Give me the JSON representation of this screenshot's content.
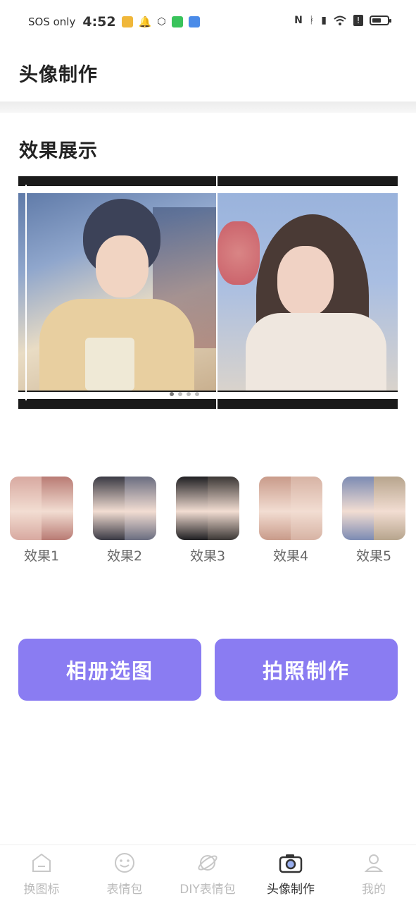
{
  "status_bar": {
    "carrier": "SOS only",
    "time": "4:52",
    "battery_level": 0.6
  },
  "header": {
    "title": "头像制作"
  },
  "showcase": {
    "title": "效果展示",
    "slide_count": 4,
    "active_slide": 0
  },
  "effects": [
    {
      "label": "效果1",
      "colors": [
        "#d8a9a0",
        "#b97b74"
      ]
    },
    {
      "label": "效果2",
      "colors": [
        "#3a3a44",
        "#6a6d80"
      ]
    },
    {
      "label": "效果3",
      "colors": [
        "#1f1f22",
        "#3b3735"
      ]
    },
    {
      "label": "效果4",
      "colors": [
        "#c99b8a",
        "#d7b3a4"
      ]
    },
    {
      "label": "效果5",
      "colors": [
        "#7c8bb3",
        "#b7a58d"
      ]
    }
  ],
  "actions": {
    "album": "相册选图",
    "camera": "拍照制作"
  },
  "nav": [
    {
      "label": "换图标",
      "icon": "home-icon",
      "active": false
    },
    {
      "label": "表情包",
      "icon": "smiley-icon",
      "active": false
    },
    {
      "label": "DIY表情包",
      "icon": "planet-icon",
      "active": false
    },
    {
      "label": "头像制作",
      "icon": "camera-icon",
      "active": true
    },
    {
      "label": "我的",
      "icon": "user-icon",
      "active": false
    }
  ],
  "colors": {
    "accent": "#8a7cf2",
    "nav_inactive": "#bbbbbb",
    "nav_active": "#333333"
  }
}
